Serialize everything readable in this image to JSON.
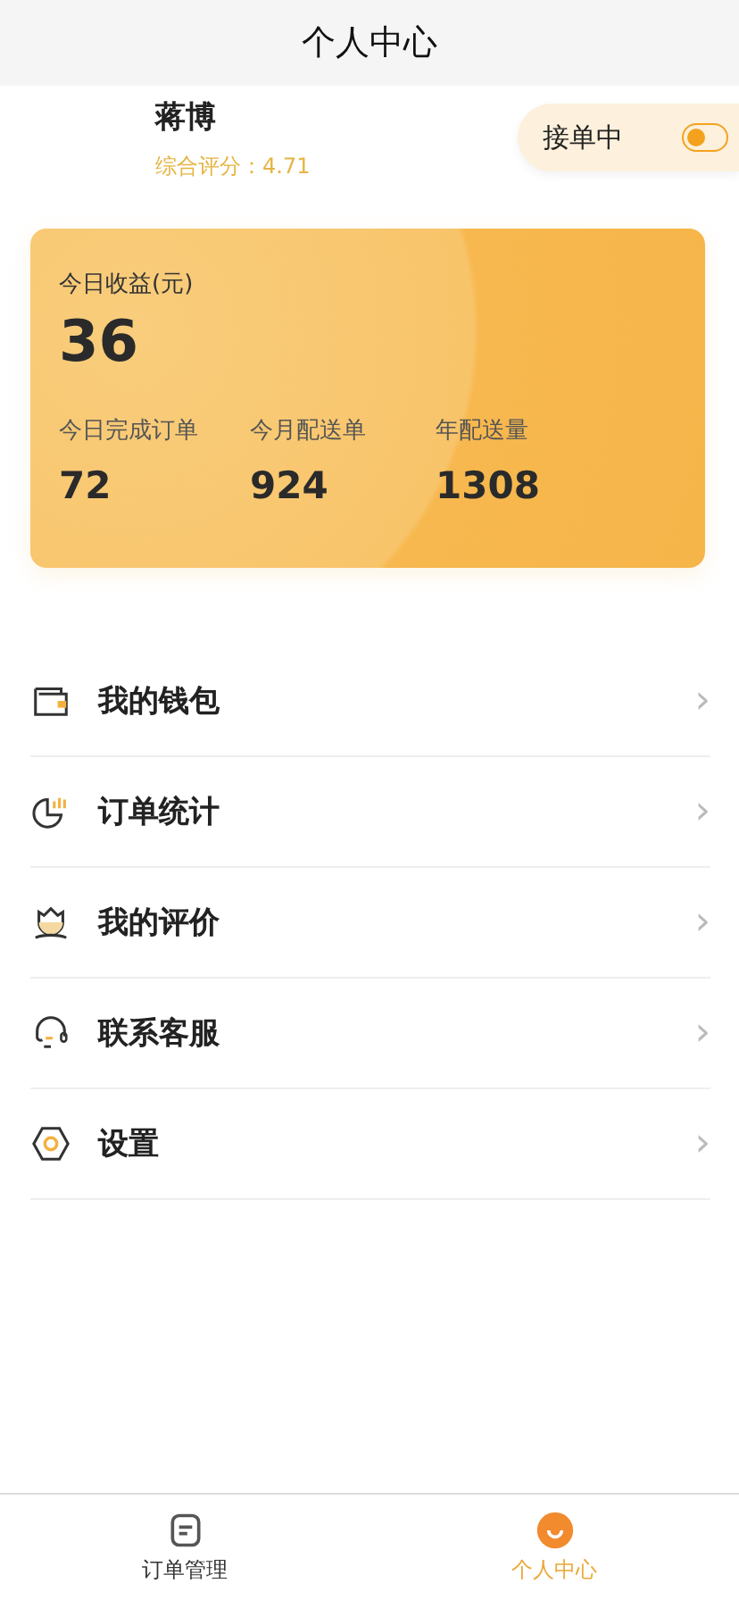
{
  "header": {
    "title": "个人中心"
  },
  "profile": {
    "name": "蒋博",
    "rating": "综合评分：4.71"
  },
  "order_toggle": {
    "label": "接单中",
    "on": false
  },
  "earnings_card": {
    "label": "今日收益(元)",
    "value": "36",
    "stats": [
      {
        "label": "今日完成订单",
        "value": "72"
      },
      {
        "label": "今月配送单",
        "value": "924"
      },
      {
        "label": "年配送量",
        "value": "1308"
      }
    ]
  },
  "menu": [
    {
      "label": "我的钱包",
      "chevron": "›"
    },
    {
      "label": "订单统计",
      "chevron": "›"
    },
    {
      "label": "我的评价",
      "chevron": "›"
    },
    {
      "label": "联系客服",
      "chevron": "›"
    },
    {
      "label": "设置",
      "chevron": "›"
    }
  ],
  "tab_bar": [
    {
      "label": "订单管理",
      "selected": false
    },
    {
      "label": "个人中心",
      "selected": true
    }
  ]
}
